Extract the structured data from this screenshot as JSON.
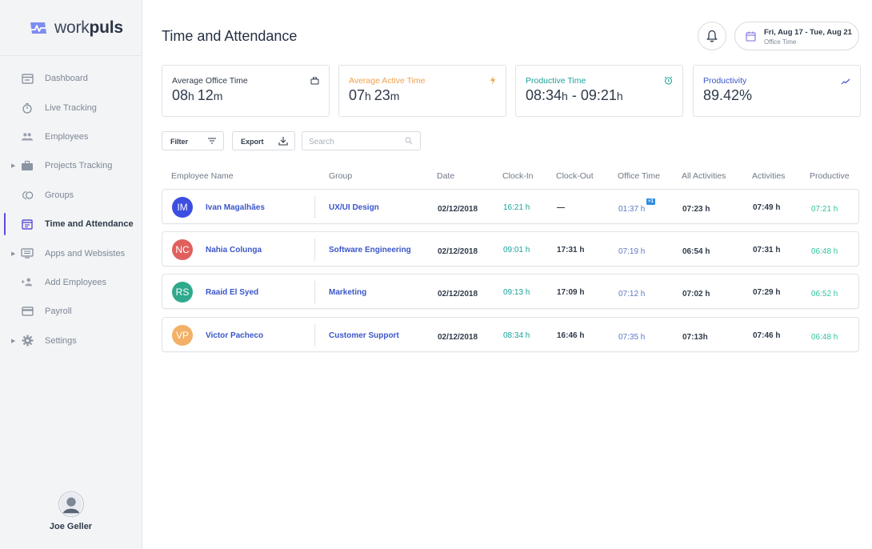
{
  "app": {
    "logo_prefix": "work",
    "logo_suffix": "puls"
  },
  "sidebar": {
    "items": [
      {
        "label": "Dashboard",
        "icon": "dashboard-icon",
        "caret": false,
        "active": false
      },
      {
        "label": "Live Tracking",
        "icon": "stopwatch-icon",
        "caret": false,
        "active": false
      },
      {
        "label": "Employees",
        "icon": "people-icon",
        "caret": false,
        "active": false
      },
      {
        "label": "Projects Tracking",
        "icon": "briefcase-icon",
        "caret": true,
        "active": false
      },
      {
        "label": "Groups",
        "icon": "groups-icon",
        "caret": false,
        "active": false
      },
      {
        "label": "Time and Attendance",
        "icon": "calendar-icon",
        "caret": false,
        "active": true
      },
      {
        "label": "Apps and Websistes",
        "icon": "monitor-icon",
        "caret": true,
        "active": false
      },
      {
        "label": "Add Employees",
        "icon": "add-user-icon",
        "caret": false,
        "active": false
      },
      {
        "label": "Payroll",
        "icon": "card-icon",
        "caret": false,
        "active": false
      },
      {
        "label": "Settings",
        "icon": "gear-icon",
        "caret": true,
        "active": false
      }
    ],
    "user": {
      "name": "Joe Geller"
    }
  },
  "header": {
    "title": "Time and Attendance",
    "date_range": "Fri, Aug 17 - Tue, Aug 21",
    "date_sub": "Office Time"
  },
  "stats": [
    {
      "title": "Average Office Time",
      "color": "#2f3a4a",
      "icon": "briefcase-icon",
      "v1": "08",
      "u1": "h ",
      "v2": "12",
      "u2": "m"
    },
    {
      "title": "Average Active Time",
      "color": "#f0a04b",
      "icon": "lightning-icon",
      "v1": "07",
      "u1": "h ",
      "v2": "23",
      "u2": "m"
    },
    {
      "title": "Productive Time",
      "color": "#1aa39a",
      "icon": "alarm-icon",
      "v1": "08:34",
      "u1": "h",
      "v2": " - 09:21",
      "u2": "h"
    },
    {
      "title": "Productivity",
      "color": "#3b56c9",
      "icon": "trend-icon",
      "v1": "89.42%",
      "u1": "",
      "v2": "",
      "u2": ""
    }
  ],
  "toolbar": {
    "filter_label": "Filter",
    "export_label": "Export",
    "search_placeholder": "Search"
  },
  "table": {
    "headers": [
      "Employee Name",
      "Group",
      "Date",
      "Clock-In",
      "Clock-Out",
      "Office Time",
      "All Activities",
      "Activities",
      "Productive"
    ],
    "rows": [
      {
        "initials": "IM",
        "avatar_color": "#3d4fe0",
        "name": "Ivan Magalhães",
        "group": "UX/UI Design",
        "date": "02/12/2018",
        "clock_in": "16:21 h",
        "clock_out": "—",
        "office_time": "01:37 h",
        "badge": "+1",
        "all_activities": "07:23 h",
        "activities": "07:49 h",
        "productive": "07:21 h"
      },
      {
        "initials": "NC",
        "avatar_color": "#e0605e",
        "name": "Nahia Colunga",
        "group": "Software Engineering",
        "date": "02/12/2018",
        "clock_in": "09:01 h",
        "clock_out": "17:31 h",
        "office_time": "07:19 h",
        "badge": "",
        "all_activities": "06:54 h",
        "activities": "07:31 h",
        "productive": "06:48 h"
      },
      {
        "initials": "RS",
        "avatar_color": "#2fa98c",
        "name": "Raaid El Syed",
        "group": "Marketing",
        "date": "02/12/2018",
        "clock_in": "09:13 h",
        "clock_out": "17:09 h",
        "office_time": "07:12 h",
        "badge": "",
        "all_activities": "07:02 h",
        "activities": "07:29 h",
        "productive": "06:52 h"
      },
      {
        "initials": "VP",
        "avatar_color": "#f2b166",
        "name": "Victor Pacheco",
        "group": "Customer Support",
        "date": "02/12/2018",
        "clock_in": "08:34 h",
        "clock_out": "16:46 h",
        "office_time": "07:35 h",
        "badge": "",
        "all_activities": "07:13h",
        "activities": "07:46 h",
        "productive": "06:48 h"
      }
    ]
  }
}
